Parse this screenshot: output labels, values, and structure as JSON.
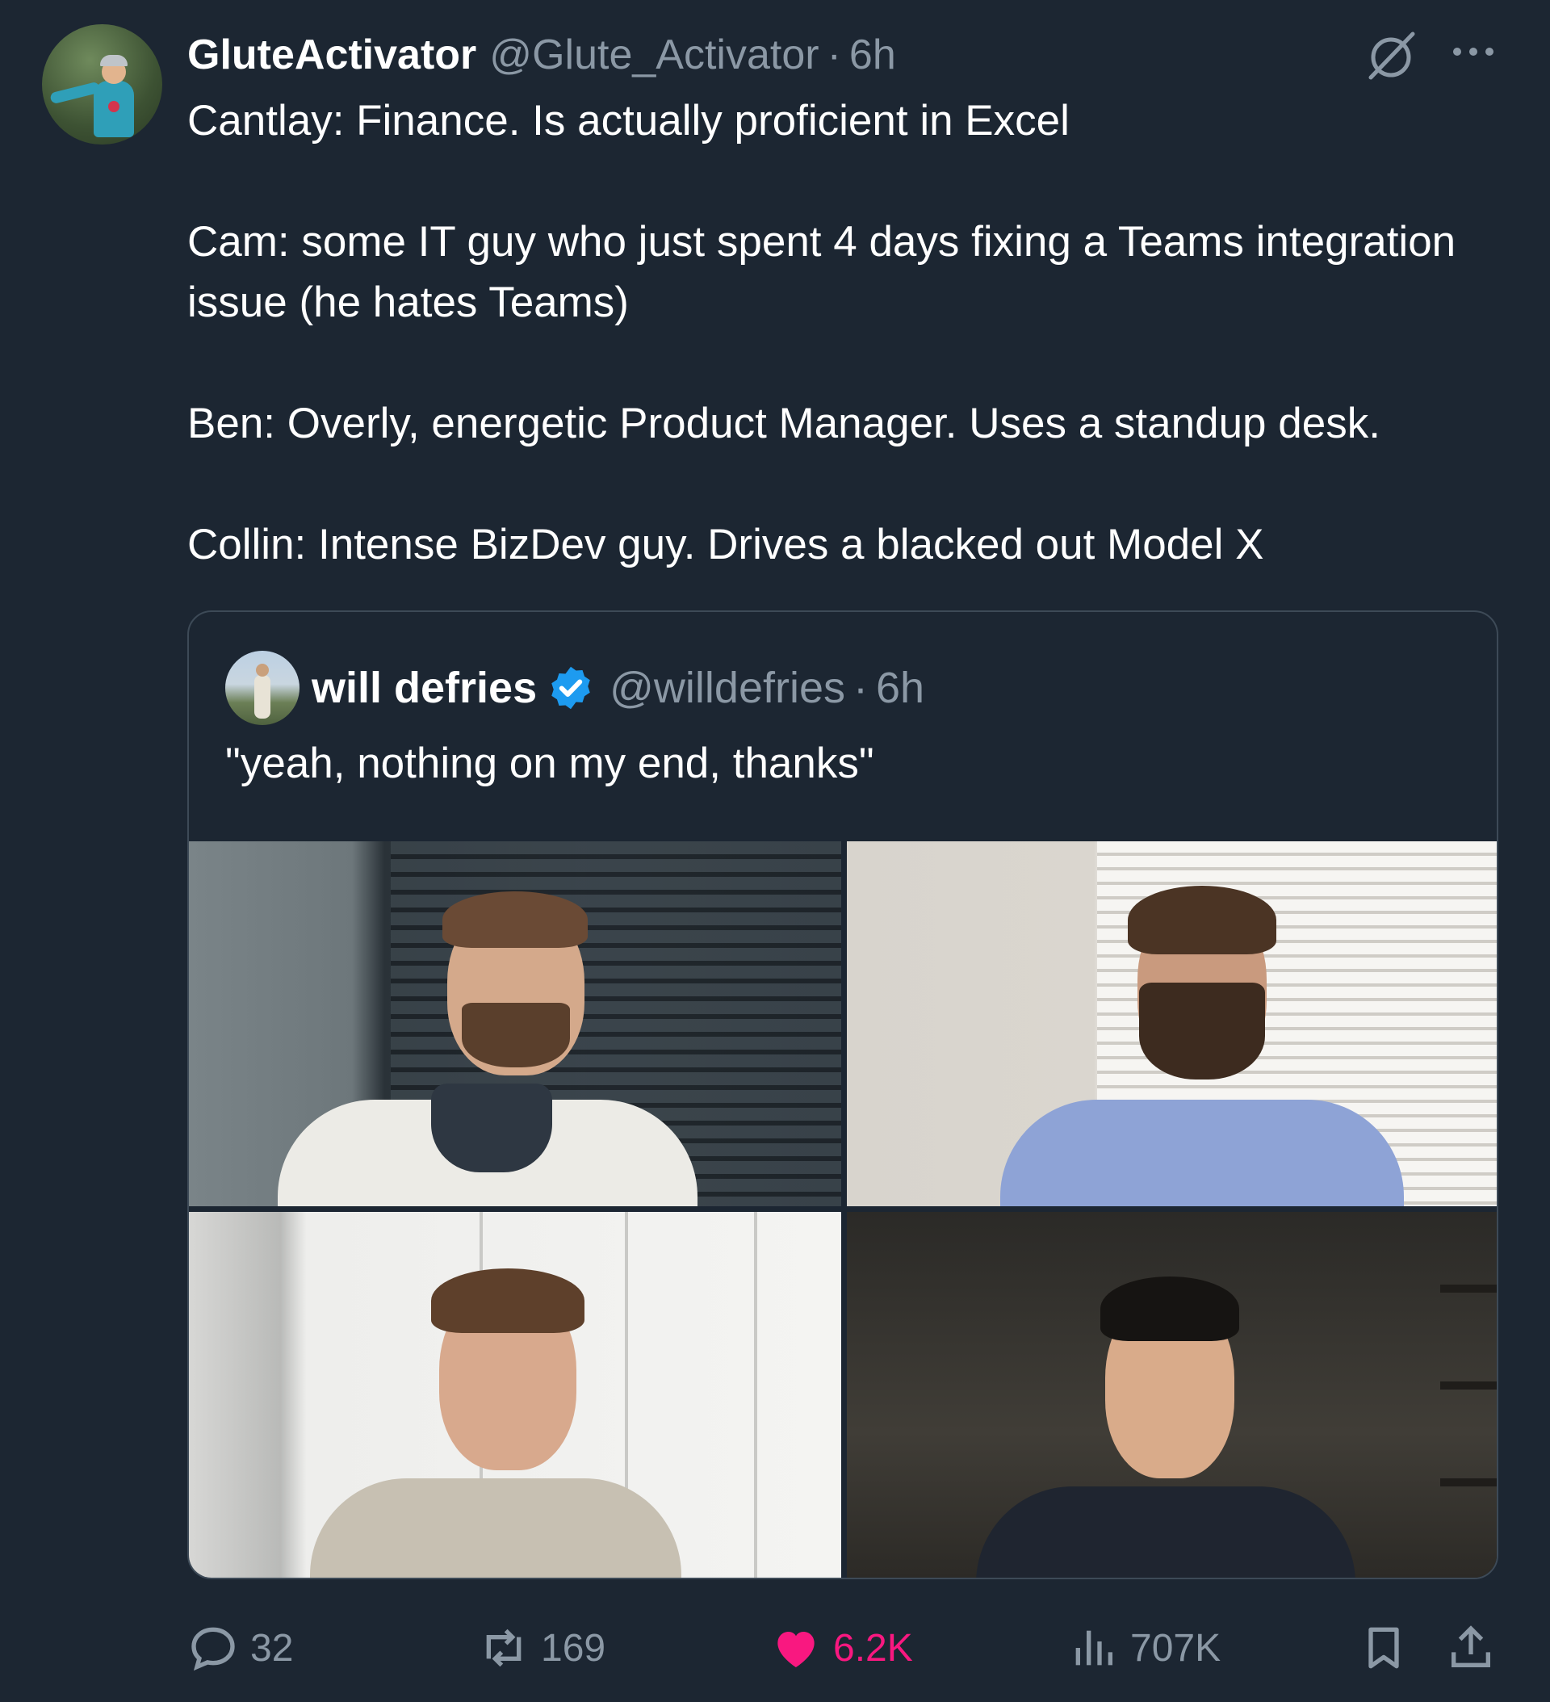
{
  "tweet": {
    "author_name": "GluteActivator",
    "author_handle": "@Glute_Activator",
    "separator": "·",
    "time": "6h",
    "lines": [
      "Cantlay: Finance. Is actually proficient in Excel",
      "Cam: some IT guy who just spent 4 days fixing a Teams integration issue (he hates Teams)",
      "Ben: Overly, energetic Product Manager. Uses a standup desk.",
      "Collin: Intense BizDev guy. Drives a blacked out Model X"
    ]
  },
  "quote": {
    "author_name": "will defries",
    "author_handle": "@willdefries",
    "separator": "·",
    "time": "6h",
    "text": "\"yeah, nothing on my end, thanks\""
  },
  "actions": {
    "replies": "32",
    "reposts": "169",
    "likes": "6.2K",
    "views": "707K"
  },
  "icons": [
    "grok-icon",
    "more-icon",
    "verified-icon",
    "reply-icon",
    "repost-icon",
    "heart-icon",
    "views-icon",
    "bookmark-icon",
    "share-icon"
  ],
  "colors": {
    "background": "#1c2632",
    "secondary_text": "#8b98a5",
    "like": "#f91880",
    "verified": "#1d9bf0"
  }
}
